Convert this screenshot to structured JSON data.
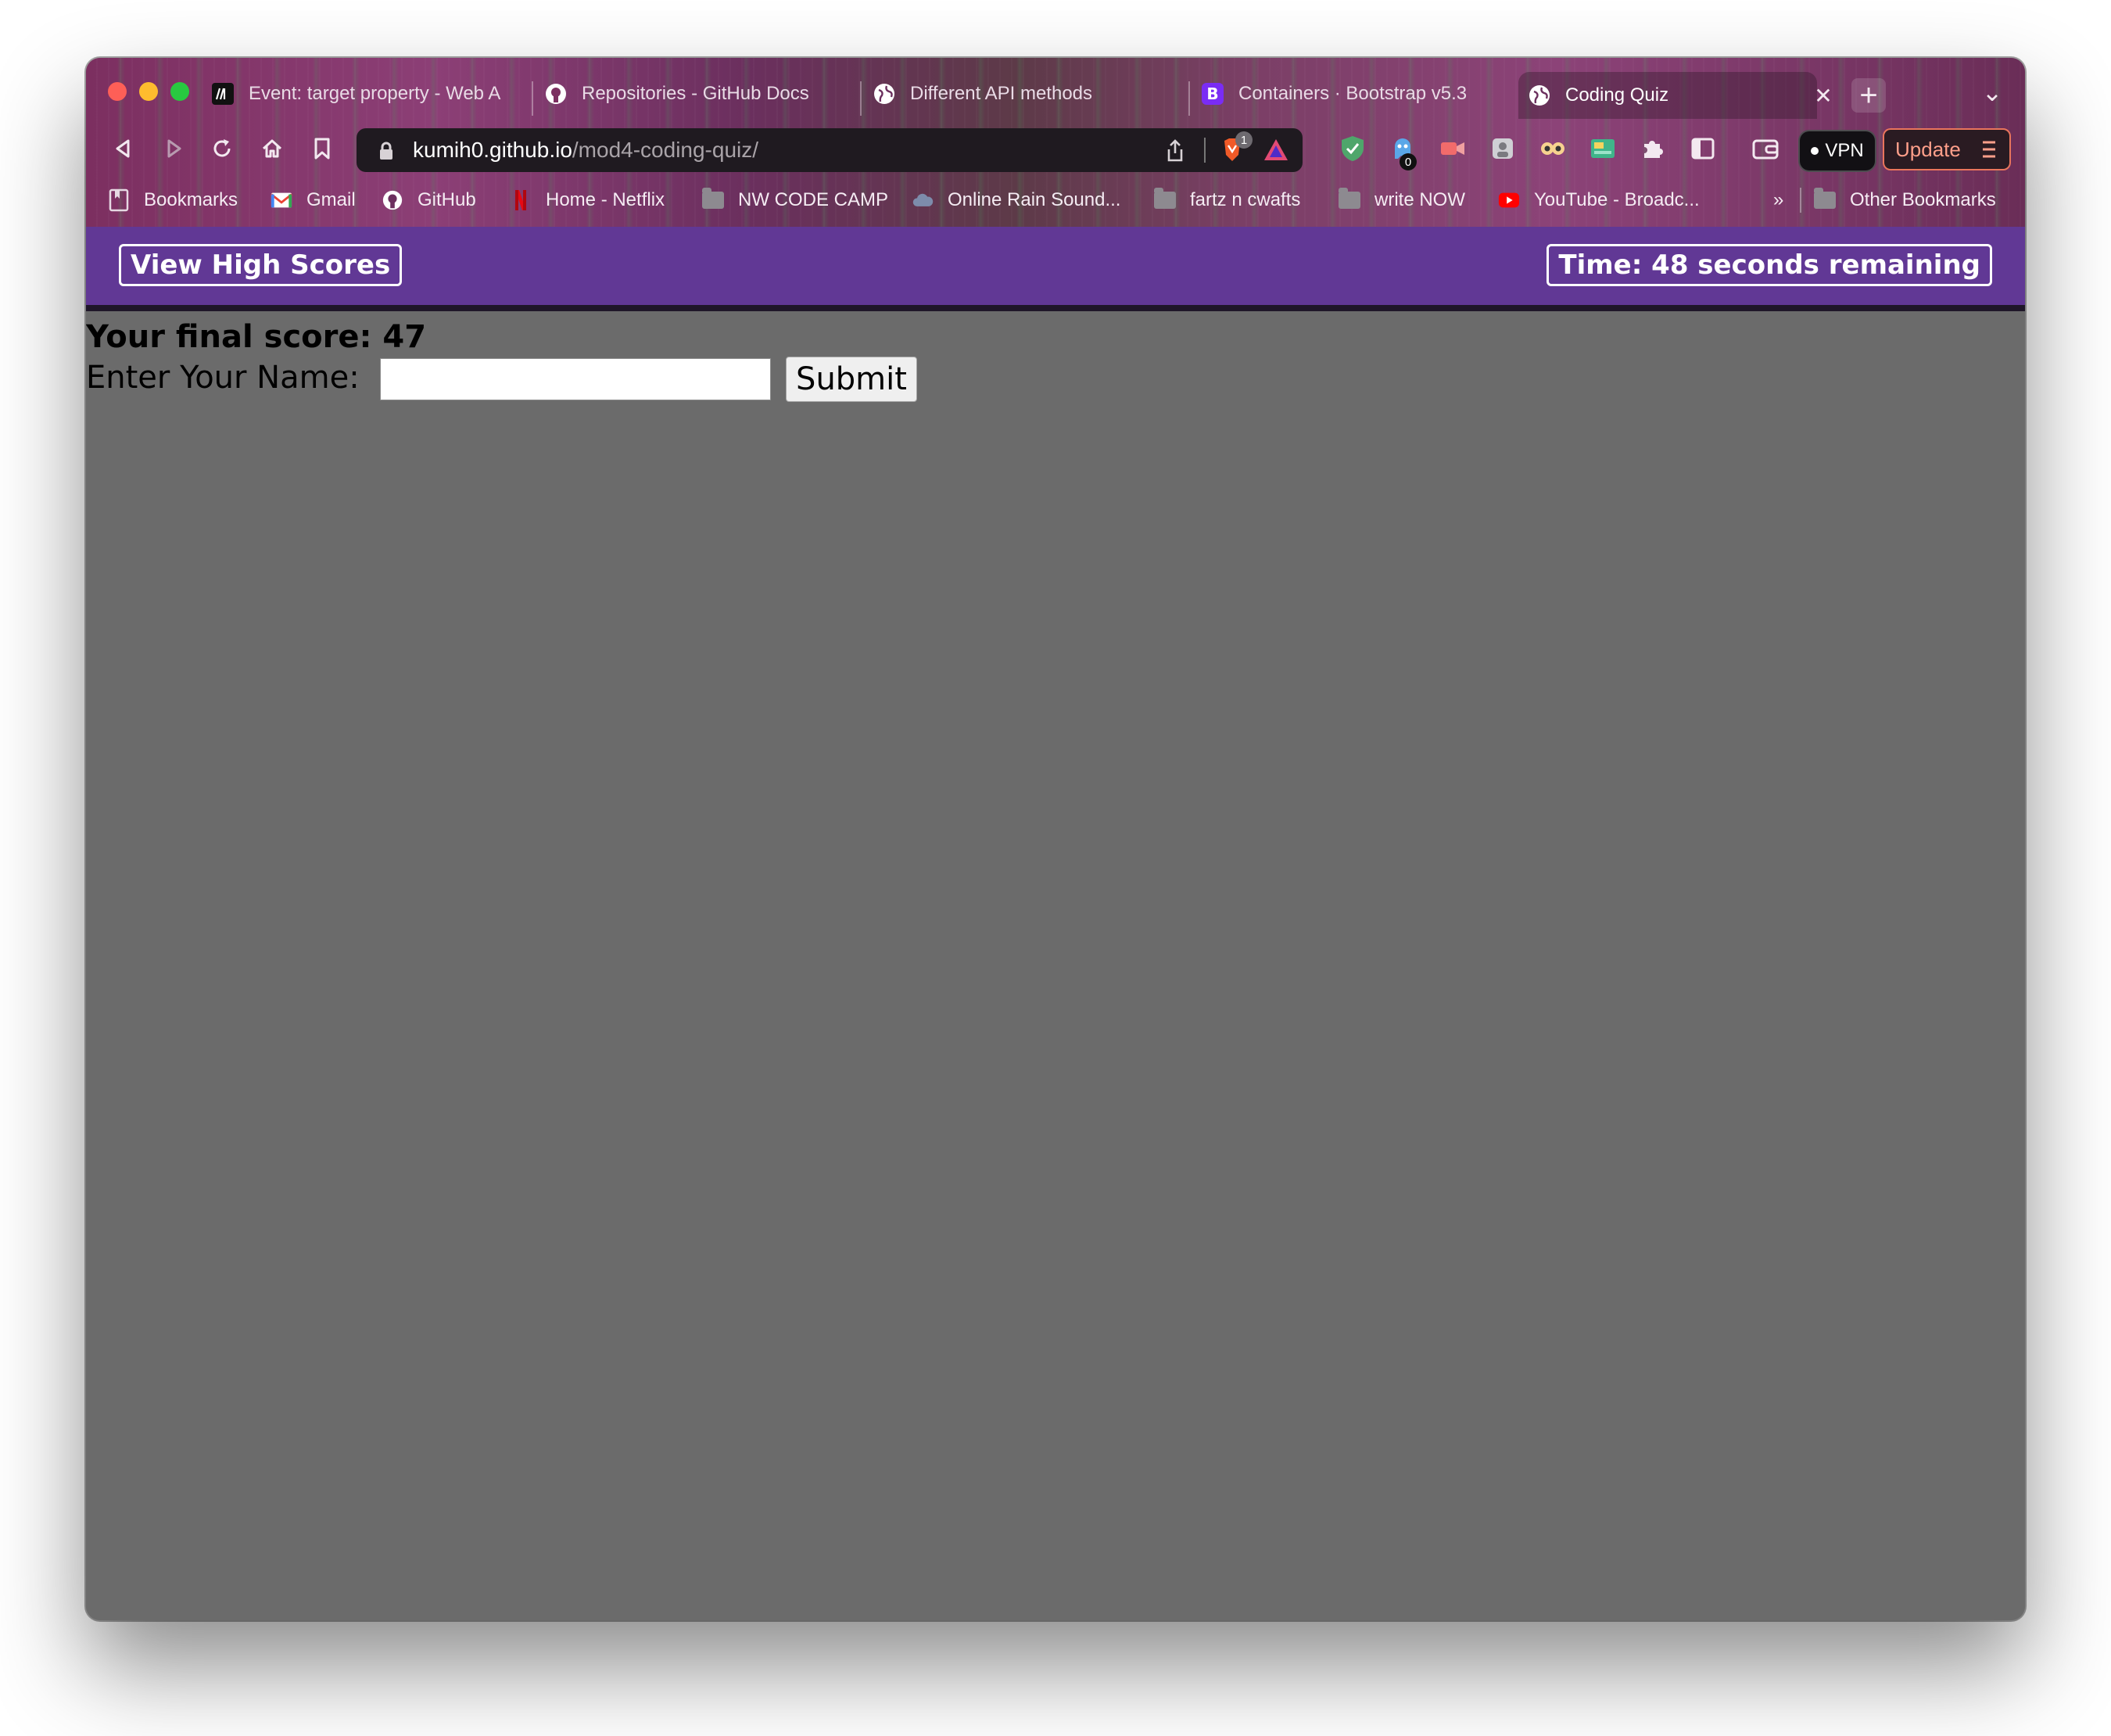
{
  "browser": {
    "tabs": [
      {
        "title": "Event: target property - Web A",
        "icon": "mdn-icon",
        "active": false
      },
      {
        "title": "Repositories - GitHub Docs",
        "icon": "github-icon",
        "active": false
      },
      {
        "title": "Different API methods",
        "icon": "globe-icon",
        "active": false
      },
      {
        "title": "Containers · Bootstrap v5.3",
        "icon": "bootstrap-icon",
        "active": false
      },
      {
        "title": "Coding Quiz",
        "icon": "globe-icon",
        "active": true
      }
    ],
    "close_tab_symbol": "✕",
    "new_tab_symbol": "+",
    "tab_menu_symbol": "⌄",
    "url_domain": "kumih0.github.io",
    "url_path": "/mod4-coding-quiz/",
    "brave_badge_count": "1",
    "extension_badge_count": "0",
    "vpn_label": "VPN",
    "update_label": "Update",
    "bookmarks": [
      {
        "label": "Bookmarks",
        "icon": "bookmarks-icon"
      },
      {
        "label": "Gmail",
        "icon": "gmail-icon"
      },
      {
        "label": "GitHub",
        "icon": "github-icon"
      },
      {
        "label": "Home - Netflix",
        "icon": "netflix-icon"
      },
      {
        "label": "NW CODE CAMP",
        "icon": "folder-icon"
      },
      {
        "label": "Online Rain Sound...",
        "icon": "cloud-icon"
      },
      {
        "label": "fartz n cwafts",
        "icon": "folder-icon"
      },
      {
        "label": "write NOW",
        "icon": "folder-icon"
      },
      {
        "label": "YouTube - Broadc...",
        "icon": "youtube-icon"
      }
    ],
    "bookmarks_overflow": "»",
    "other_bookmarks": "Other Bookmarks",
    "colors": {
      "header_purple": "#613895",
      "page_background": "#6b6b6b"
    }
  },
  "quiz": {
    "view_high_scores": "View High Scores",
    "timer": "Time: 48 seconds remaining",
    "final_score": "Your final score: 47",
    "name_label": "Enter Your Name:",
    "name_value": "",
    "submit_label": "Submit"
  }
}
